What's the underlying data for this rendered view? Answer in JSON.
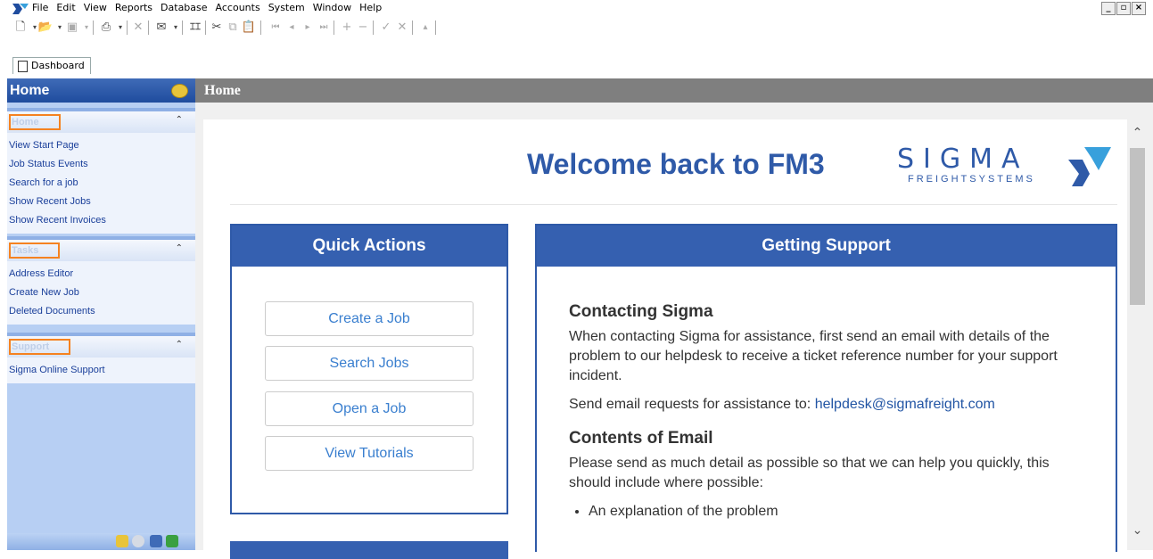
{
  "menu": {
    "items": [
      "File",
      "Edit",
      "View",
      "Reports",
      "Database",
      "Accounts",
      "System",
      "Window",
      "Help"
    ],
    "window_controls": [
      "_",
      "▫",
      "×"
    ]
  },
  "tabs": [
    {
      "label": "Dashboard"
    }
  ],
  "sidebar": {
    "header": "Home",
    "sections": [
      {
        "title": "Home",
        "items": [
          "View Start Page",
          "Job Status Events",
          "Search for a job",
          "Show Recent Jobs",
          "Show Recent Invoices"
        ]
      },
      {
        "title": "Tasks",
        "items": [
          "Address Editor",
          "Create New Job",
          "Deleted Documents"
        ]
      },
      {
        "title": "Support",
        "items": [
          "Sigma Online Support"
        ]
      }
    ]
  },
  "main": {
    "header": "Home",
    "welcome": "Welcome back to FM3",
    "brand": {
      "name": "SIGMA",
      "tagline": "FREIGHTSYSTEMS"
    },
    "quick_actions": {
      "title": "Quick Actions",
      "buttons": [
        "Create a Job",
        "Search Jobs",
        "Open a Job",
        "View Tutorials"
      ]
    },
    "support": {
      "title": "Getting Support",
      "contacting_title": "Contacting Sigma",
      "contacting_text": "When contacting Sigma for assistance, first send an email with details of the problem to our helpdesk to receive a ticket reference number for your support incident.",
      "send_prefix": "Send email requests for assistance to: ",
      "email": "helpdesk@sigmafreight.com",
      "contents_title": "Contents of Email",
      "contents_text": "Please send as much detail as possible so that we can help you quickly, this should include where possible:",
      "bullets": [
        "An explanation of the problem"
      ]
    }
  },
  "colors": {
    "accent": "#2f5aa8",
    "highlight": "#f58220",
    "sidebar": "#b7cff3"
  }
}
